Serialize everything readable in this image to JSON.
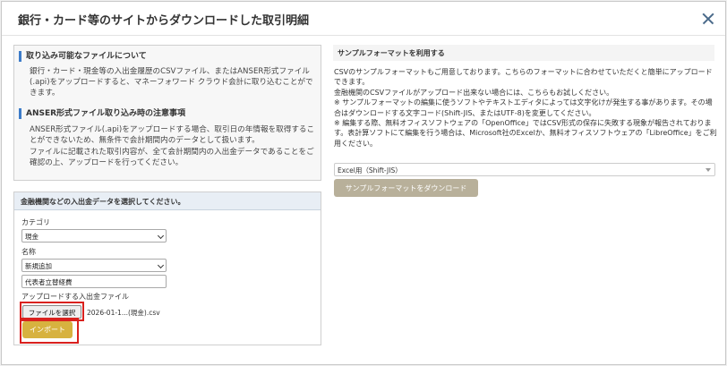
{
  "modal": {
    "title": "銀行・カード等のサイトからダウンロードした取引明細"
  },
  "info": {
    "heading1": "取り込み可能なファイルについて",
    "body1": "銀行・カード・現金等の入出金履歴のCSVファイル、またはANSER形式ファイル(.api)をアップロードすると、マネーフォワード クラウド会計に取り込むことができます。",
    "heading2": "ANSER形式ファイル取り込み時の注意事項",
    "body2_line1": "ANSER形式ファイル(.api)をアップロードする場合、取引日の年情報を取得することができないため、無条件で会計期間内のデータとして扱います。",
    "body2_line2": "ファイルに記載された取引内容が、全て会計期間内の入出金データであることをご確認の上、アップロードを行ってください。"
  },
  "upload": {
    "header": "金融機関などの入出金データを選択してください。",
    "category_label": "カテゴリ",
    "category_value": "現金",
    "name_label": "名称",
    "name_value": "新規追加",
    "name_input_value": "代表者立替経費",
    "file_label": "アップロードする入出金ファイル",
    "file_button": "ファイルを選択",
    "file_name": "2026-01-1...(現金).csv",
    "import_button": "インポート"
  },
  "sample": {
    "header": "サンプルフォーマットを利用する",
    "lines": [
      "CSVのサンプルフォーマットもご用意しております。こちらのフォーマットに合わせていただくと簡単にアップロードできます。",
      "金融機関のCSVファイルがアップロード出来ない場合には、こちらもお試しください。",
      "※ サンプルフォーマットの編集に使うソフトやテキストエディタによっては文字化けが発生する事があります。その場合はダウンロードする文字コード(Shift-JIS、またはUTF-8)を変更してください。",
      "※ 編集する際、無料オフィスソフトウェアの「OpenOffice」ではCSV形式の保存に失敗する現象が報告されております。表計算ソフトにて編集を行う場合は、Microsoft社のExcelか、無料オフィスソフトウェアの「LibreOffice」をご利用ください。"
    ],
    "format_value": "Excel用（Shift-JIS）",
    "download_button": "サンプルフォーマットをダウンロード"
  },
  "colors": {
    "accent_blue": "#3d7cc9",
    "import_gold": "#d7b23f",
    "highlight_red": "#d9211e"
  }
}
